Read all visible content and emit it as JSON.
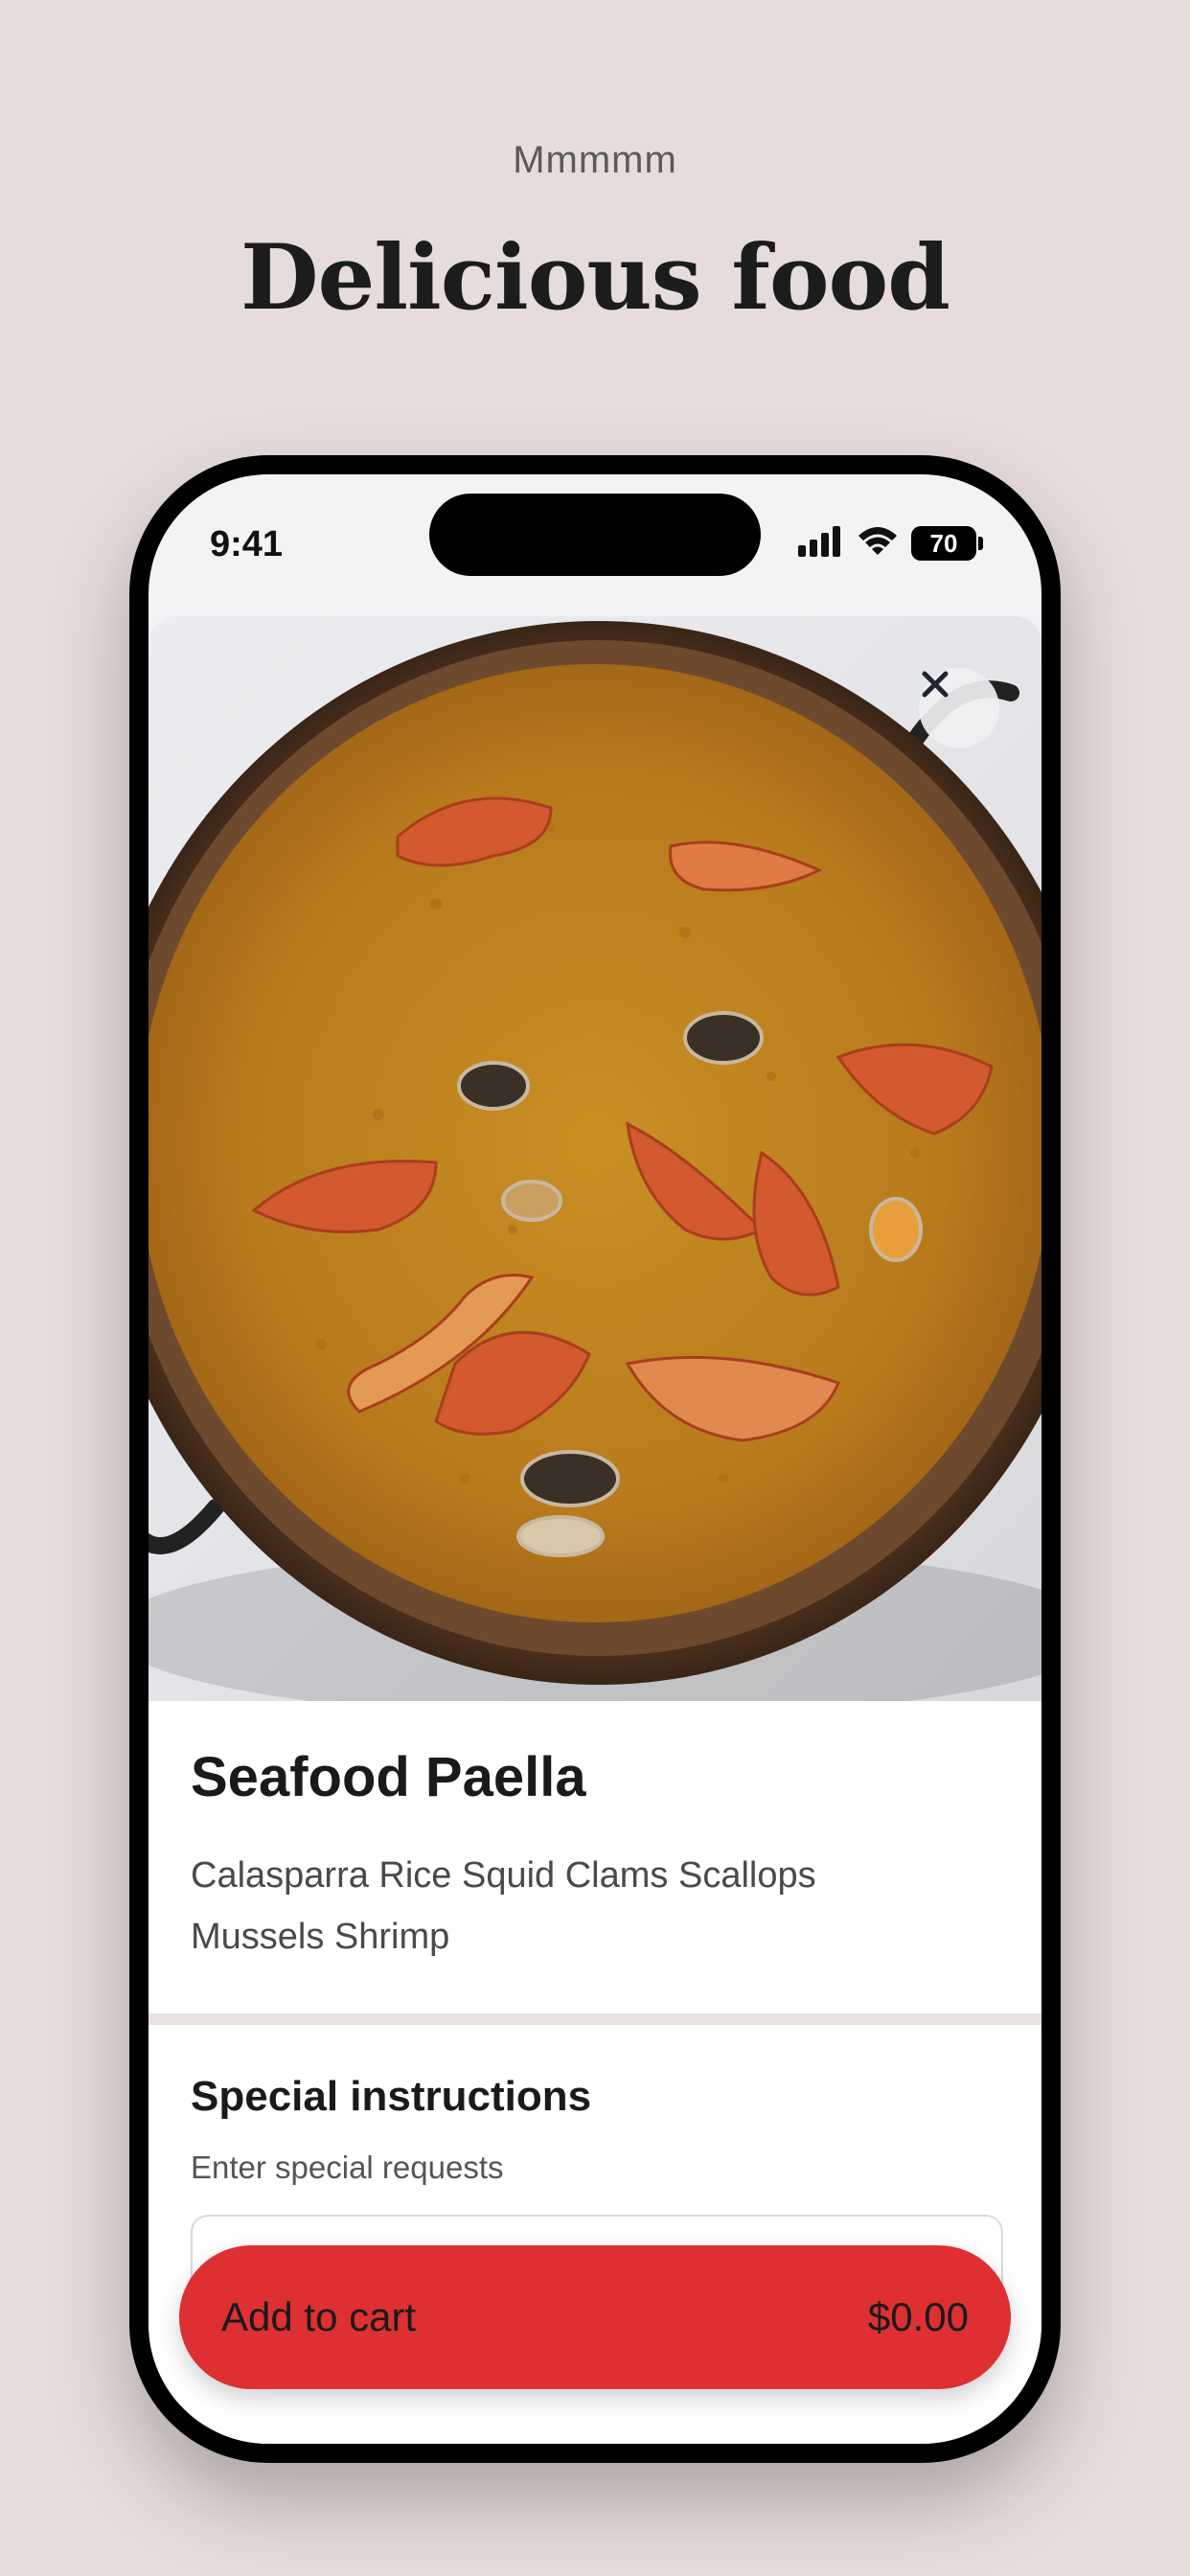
{
  "header": {
    "eyebrow": "Mmmmm",
    "headline": "Delicious food"
  },
  "status_bar": {
    "time": "9:41",
    "battery": "70",
    "icons": [
      "signal-icon",
      "wifi-icon",
      "battery-icon"
    ]
  },
  "product": {
    "image_icon": "paella-photo",
    "title": "Seafood Paella",
    "description": "Calasparra Rice Squid Clams Scallops Mussels Shrimp",
    "close_icon": "close-icon"
  },
  "instructions": {
    "title": "Special instructions",
    "hint": "Enter special requests",
    "value": ""
  },
  "cart_button": {
    "label": "Add to cart",
    "price": "$0.00"
  },
  "colors": {
    "background": "#e6dcdb",
    "accent": "#de2f32"
  }
}
